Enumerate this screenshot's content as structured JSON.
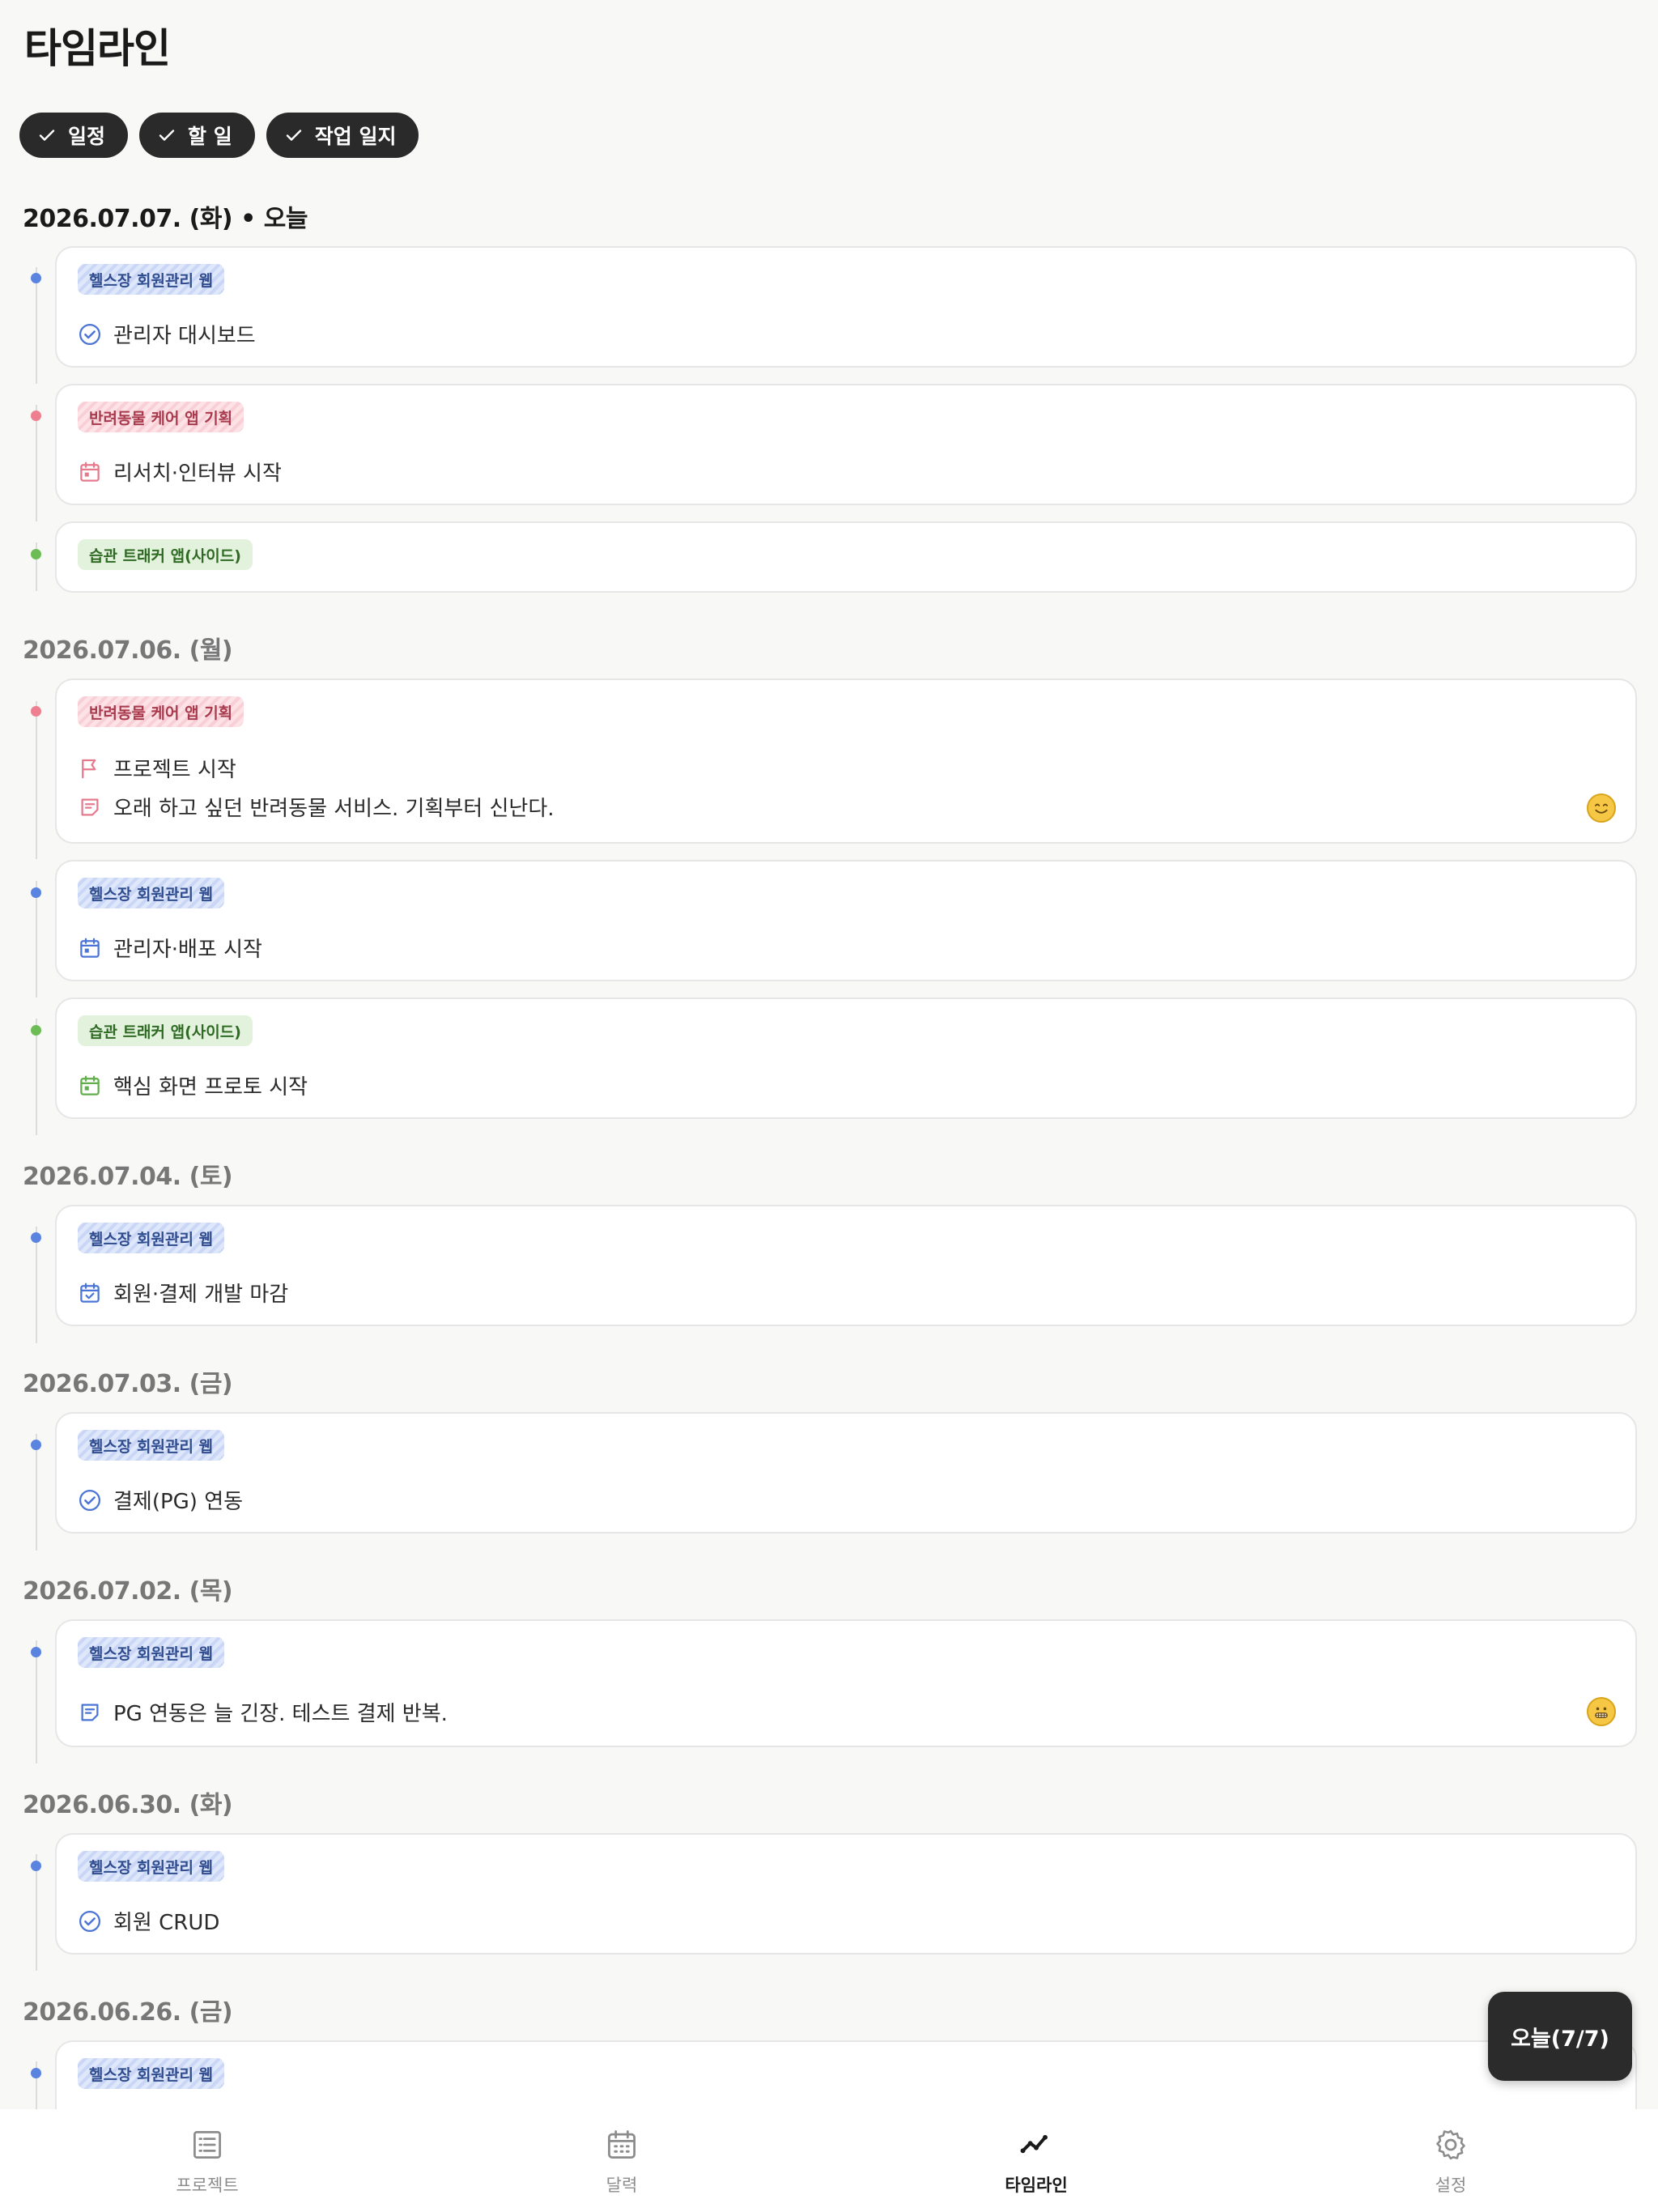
{
  "page": {
    "title": "타임라인"
  },
  "filters": [
    {
      "label": "일정",
      "checked": true
    },
    {
      "label": "할 일",
      "checked": true
    },
    {
      "label": "작업 일지",
      "checked": true
    }
  ],
  "projects": {
    "gym": {
      "name": "헬스장 회원관리 웹",
      "color": "#5b84e0"
    },
    "pet": {
      "name": "반려동물 케어 앱 기획",
      "color": "#ee7f90"
    },
    "habit": {
      "name": "습관 트래커 앱(사이드)",
      "color": "#6cbd55"
    }
  },
  "today_separator": "•",
  "days": [
    {
      "date": "2026.07.07. (화)",
      "today_label": "오늘",
      "entries": [
        {
          "project": "헬스장 회원관리 웹",
          "color": "blue",
          "items": [
            {
              "icon": "check-circle-icon",
              "text": "관리자 대시보드"
            }
          ]
        },
        {
          "project": "반려동물 케어 앱 기획",
          "color": "pink",
          "items": [
            {
              "icon": "calendar-icon",
              "text": "리서치·인터뷰 시작"
            }
          ]
        },
        {
          "project": "습관 트래커 앱(사이드)",
          "color": "green",
          "items": []
        }
      ]
    },
    {
      "date": "2026.07.06. (월)",
      "entries": [
        {
          "project": "반려동물 케어 앱 기획",
          "color": "pink",
          "items": [
            {
              "icon": "flag-icon",
              "text": "프로젝트 시작"
            },
            {
              "icon": "note-icon",
              "text": "오래 하고 싶던 반려동물 서비스. 기획부터 신난다."
            }
          ],
          "mood": "smile"
        },
        {
          "project": "헬스장 회원관리 웹",
          "color": "blue",
          "items": [
            {
              "icon": "calendar-icon",
              "text": "관리자·배포 시작"
            }
          ]
        },
        {
          "project": "습관 트래커 앱(사이드)",
          "color": "green",
          "items": [
            {
              "icon": "calendar-icon",
              "text": "핵심 화면 프로토 시작"
            }
          ]
        }
      ]
    },
    {
      "date": "2026.07.04. (토)",
      "entries": [
        {
          "project": "헬스장 회원관리 웹",
          "color": "blue",
          "items": [
            {
              "icon": "calendar-check-icon",
              "text": "회원·결제 개발 마감"
            }
          ]
        }
      ]
    },
    {
      "date": "2026.07.03. (금)",
      "entries": [
        {
          "project": "헬스장 회원관리 웹",
          "color": "blue",
          "items": [
            {
              "icon": "check-circle-icon",
              "text": "결제(PG) 연동"
            }
          ]
        }
      ]
    },
    {
      "date": "2026.07.02. (목)",
      "entries": [
        {
          "project": "헬스장 회원관리 웹",
          "color": "blue",
          "items": [
            {
              "icon": "note-icon",
              "text": "PG 연동은 늘 긴장. 테스트 결제 반복."
            }
          ],
          "mood": "grimace"
        }
      ]
    },
    {
      "date": "2026.06.30. (화)",
      "entries": [
        {
          "project": "헬스장 회원관리 웹",
          "color": "blue",
          "items": [
            {
              "icon": "check-circle-icon",
              "text": "회원 CRUD"
            }
          ]
        }
      ]
    },
    {
      "date": "2026.06.26. (금)",
      "entries": [
        {
          "project": "헬스장 회원관리 웹",
          "color": "blue",
          "items": []
        }
      ]
    }
  ],
  "today_button": "오늘(7/7)",
  "tabs": [
    {
      "label": "프로젝트",
      "icon": "list-icon",
      "active": false
    },
    {
      "label": "달력",
      "icon": "calendar-icon",
      "active": false
    },
    {
      "label": "타임라인",
      "icon": "timeline-icon",
      "active": true
    },
    {
      "label": "설정",
      "icon": "gear-icon",
      "active": false
    }
  ]
}
